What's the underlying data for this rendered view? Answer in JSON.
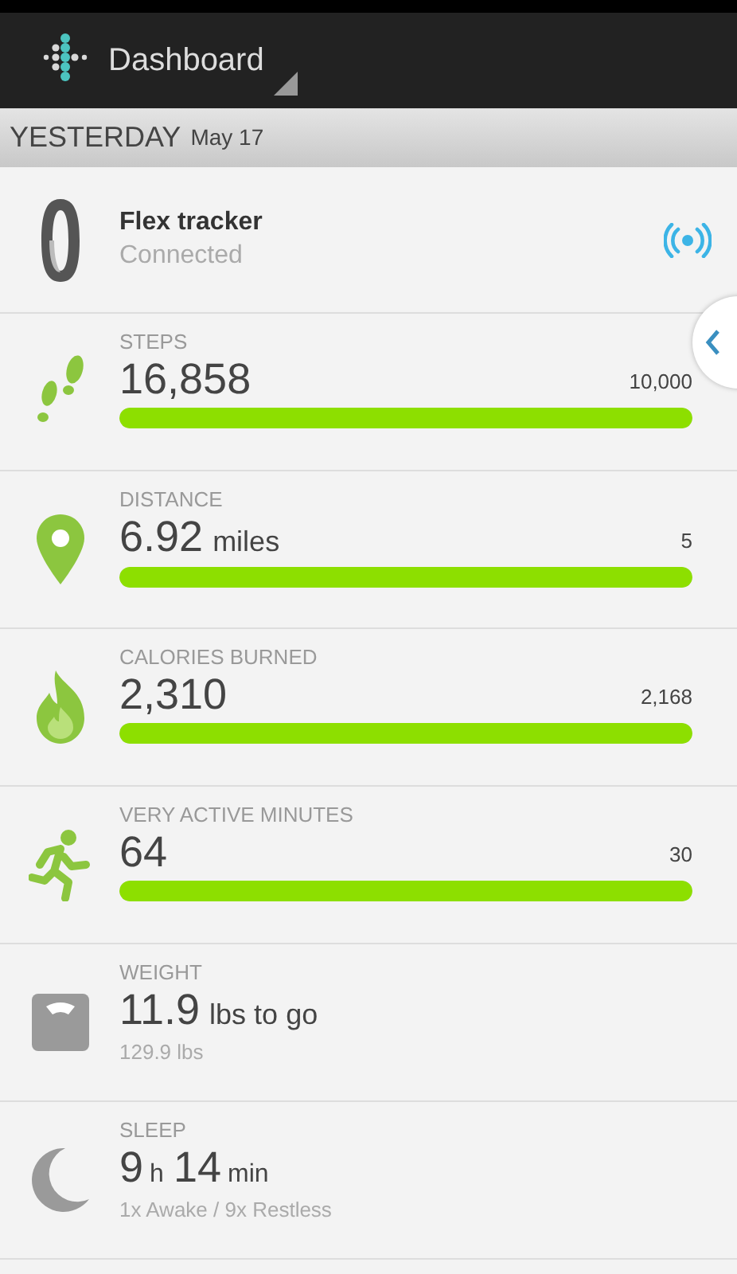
{
  "app_bar": {
    "title": "Dashboard"
  },
  "date_header": {
    "day": "YESTERDAY",
    "date": "May 17"
  },
  "tracker": {
    "name": "Flex tracker",
    "status": "Connected"
  },
  "stats": [
    {
      "kind": "progress",
      "label": "STEPS",
      "value": [
        {
          "kind": "num",
          "text": "16,858"
        }
      ],
      "goal": "10,000",
      "level": 1
    },
    {
      "kind": "progress",
      "label": "DISTANCE",
      "value": [
        {
          "kind": "num",
          "text": "6.92"
        },
        {
          "kind": "unit",
          "text": "miles"
        }
      ],
      "goal": "5",
      "level": 1
    },
    {
      "kind": "progress",
      "label": "CALORIES BURNED",
      "value": [
        {
          "kind": "num",
          "text": "2,310"
        }
      ],
      "goal": "2,168",
      "level": 1
    },
    {
      "kind": "progress",
      "label": "VERY ACTIVE MINUTES",
      "value": [
        {
          "kind": "num",
          "text": "64"
        }
      ],
      "goal": "30",
      "level": 1
    },
    {
      "kind": "detail",
      "label": "WEIGHT",
      "value": [
        {
          "kind": "num",
          "text": "11.9"
        },
        {
          "kind": "unit",
          "text": "lbs to go"
        }
      ],
      "detail": "129.9 lbs"
    },
    {
      "kind": "detail",
      "label": "SLEEP",
      "value": [
        {
          "kind": "num",
          "text": "9"
        },
        {
          "kind": "small",
          "text": "h"
        },
        {
          "kind": "num",
          "text": "14"
        },
        {
          "kind": "small",
          "text": "min"
        }
      ],
      "detail": "1x Awake / 9x Restless"
    }
  ]
}
